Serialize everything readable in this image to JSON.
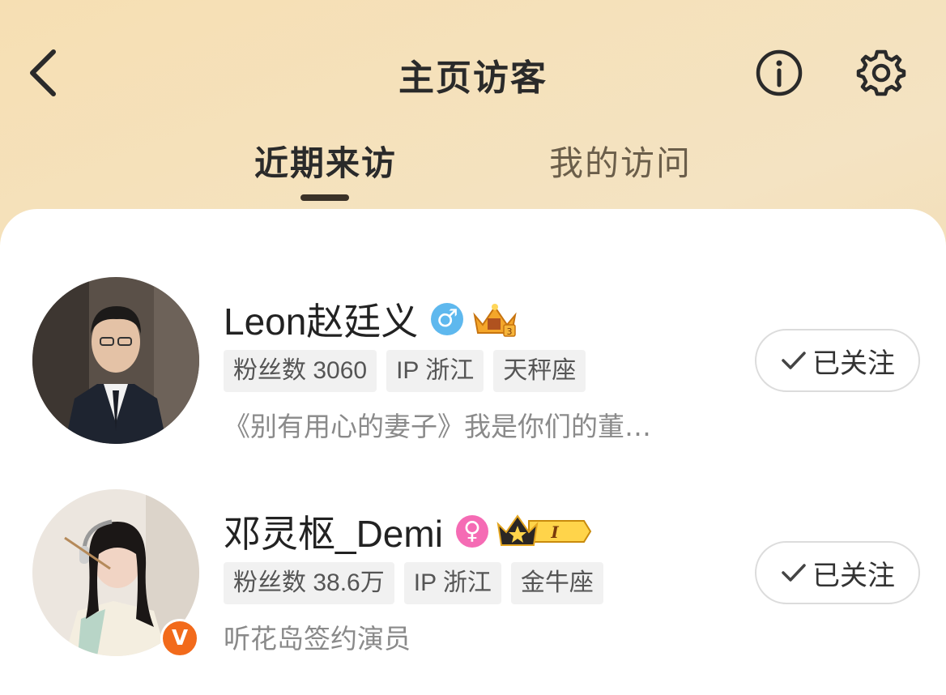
{
  "header": {
    "title": "主页访客",
    "tabs": [
      {
        "label": "近期来访",
        "active": true
      },
      {
        "label": "我的访问",
        "active": false
      }
    ]
  },
  "colors": {
    "header_bg": "#f4e3c2",
    "male_badge": "#5eb8ee",
    "female_badge": "#f56bb4",
    "verified_badge": "#f26a1b",
    "tag_bg": "#f1f1f1"
  },
  "visitors": [
    {
      "name": "Leon赵廷义",
      "gender_icon": "male-icon",
      "level_badge": "crown-level-3-badge",
      "tags": [
        "粉丝数 3060",
        "IP 浙江",
        "天秤座"
      ],
      "bio": "《别有用心的妻子》我是你们的董…",
      "follow_label": "已关注",
      "verified": false
    },
    {
      "name": "邓灵枢_Demi",
      "gender_icon": "female-icon",
      "level_badge": "crown-level-1-badge",
      "level_text": "I",
      "tags": [
        "粉丝数 38.6万",
        "IP 浙江",
        "金牛座"
      ],
      "bio": "听花岛签约演员",
      "follow_label": "已关注",
      "verified": true,
      "verified_text": "V"
    }
  ]
}
